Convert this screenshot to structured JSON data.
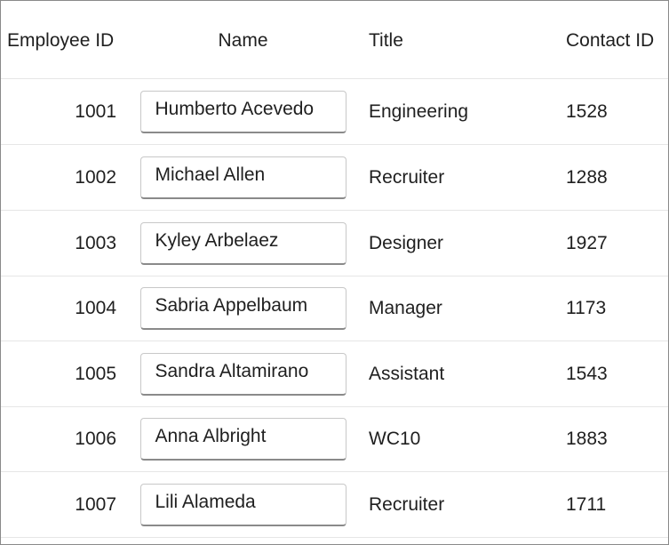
{
  "columns": {
    "employee_id": "Employee ID",
    "name": "Name",
    "title": "Title",
    "contact_id": "Contact ID"
  },
  "rows": [
    {
      "employee_id": "1001",
      "name": "Humberto Acevedo",
      "title": "Engineering",
      "contact_id": "1528"
    },
    {
      "employee_id": "1002",
      "name": "Michael Allen",
      "title": "Recruiter",
      "contact_id": "1288"
    },
    {
      "employee_id": "1003",
      "name": "Kyley Arbelaez",
      "title": "Designer",
      "contact_id": "1927"
    },
    {
      "employee_id": "1004",
      "name": "Sabria Appelbaum",
      "title": "Manager",
      "contact_id": "1173"
    },
    {
      "employee_id": "1005",
      "name": "Sandra Altamirano",
      "title": "Assistant",
      "contact_id": "1543"
    },
    {
      "employee_id": "1006",
      "name": "Anna Albright",
      "title": "WC10",
      "contact_id": "1883"
    },
    {
      "employee_id": "1007",
      "name": "Lili Alameda",
      "title": "Recruiter",
      "contact_id": "1711"
    }
  ]
}
